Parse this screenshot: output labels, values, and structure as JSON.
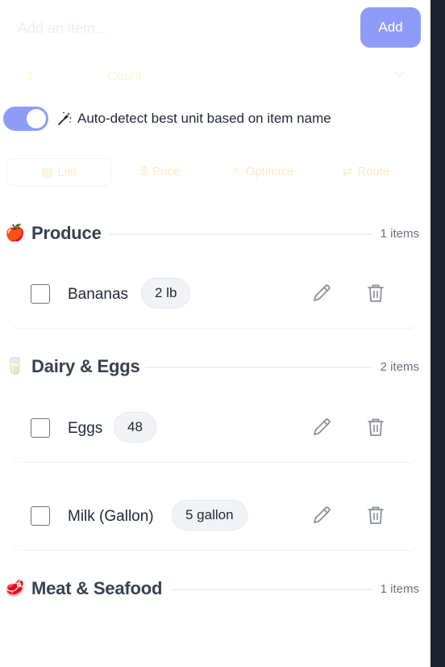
{
  "add_form": {
    "item_placeholder": "Add an item...",
    "add_label": "Add",
    "quantity": "1",
    "unit": "Count"
  },
  "auto_detect": {
    "enabled": true,
    "label": "Auto-detect best unit based on item name"
  },
  "tabs": [
    {
      "label": "List",
      "icon": "list-icon",
      "active": true
    },
    {
      "label": "Price",
      "icon": "dollar-icon",
      "active": false
    },
    {
      "label": "Optimize",
      "icon": "lightning-icon",
      "active": false
    },
    {
      "label": "Route",
      "icon": "route-icon",
      "active": false
    }
  ],
  "sections": [
    {
      "emoji": "🍎",
      "title": "Produce",
      "count_label": "1 items",
      "items": [
        {
          "name": "Bananas",
          "qty": "2 lb"
        }
      ]
    },
    {
      "emoji": "🥛",
      "title": "Dairy & Eggs",
      "count_label": "2 items",
      "items": [
        {
          "name": "Eggs",
          "qty": "48"
        },
        {
          "name": "Milk (Gallon)",
          "qty": "5 gallon"
        }
      ]
    },
    {
      "emoji": "🥩",
      "title": "Meat & Seafood",
      "count_label": "1 items",
      "items": []
    }
  ],
  "colors": {
    "accent": "#8f9cf7",
    "text": "#1f2937",
    "muted": "#6b7280",
    "badge_bg": "#f1f3f7"
  }
}
